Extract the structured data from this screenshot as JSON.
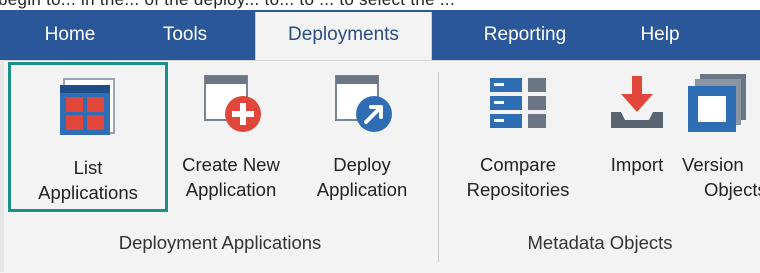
{
  "top_text": "begin to... in the... of the deploy... to... to ... to select the ...",
  "tabs": [
    {
      "label": "Home"
    },
    {
      "label": "Tools"
    },
    {
      "label": "Deployments"
    },
    {
      "label": "Reporting"
    },
    {
      "label": "Help"
    }
  ],
  "groups": [
    {
      "label": "Deployment Applications",
      "buttons": [
        {
          "line1": "List",
          "line2": "Applications",
          "icon": "list-applications-icon",
          "selected": true
        },
        {
          "line1": "Create New",
          "line2": "Application",
          "icon": "create-new-application-icon"
        },
        {
          "line1": "Deploy",
          "line2": "Application",
          "icon": "deploy-application-icon"
        }
      ]
    },
    {
      "label": "Metadata Objects",
      "buttons": [
        {
          "line1": "Compare",
          "line2": "Repositories",
          "icon": "compare-repositories-icon"
        },
        {
          "line1": "Import",
          "line2": "",
          "icon": "import-icon"
        },
        {
          "line1": "Version",
          "line2": "Objects",
          "icon": "version-objects-icon"
        }
      ]
    }
  ],
  "colors": {
    "tabbar": "#2a579a",
    "selection_border": "#1a8f8a",
    "accent_red": "#e0463a",
    "accent_blue": "#2f6db5"
  }
}
